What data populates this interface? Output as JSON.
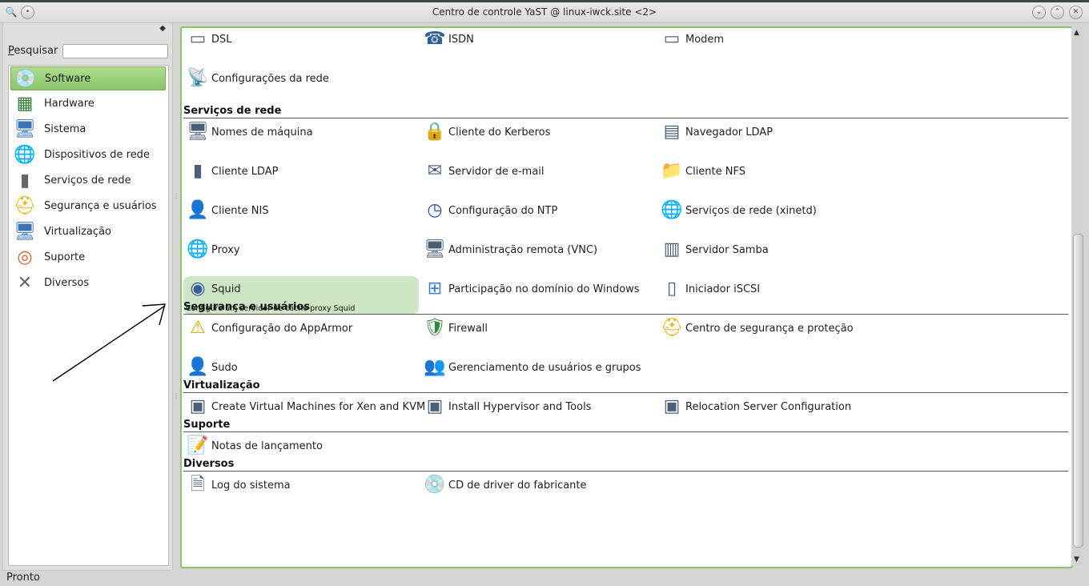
{
  "window": {
    "title": "Centro de controle YaST @ linux-iwck.site <2>"
  },
  "left": {
    "search_label": "Pesquisar",
    "search_value": "",
    "categories": [
      {
        "label": "Software",
        "icon": "software-icon",
        "active": true
      },
      {
        "label": "Hardware",
        "icon": "hardware-icon"
      },
      {
        "label": "Sistema",
        "icon": "system-monitor-icon"
      },
      {
        "label": "Dispositivos de rede",
        "icon": "network-globe-icon"
      },
      {
        "label": "Serviços de rede",
        "icon": "network-services-icon"
      },
      {
        "label": "Segurança e usuários",
        "icon": "security-helmet-icon"
      },
      {
        "label": "Virtualização",
        "icon": "virtualization-icon"
      },
      {
        "label": "Suporte",
        "icon": "lifebuoy-icon"
      },
      {
        "label": "Diversos",
        "icon": "tools-icon"
      }
    ]
  },
  "main": {
    "top_items": [
      {
        "label": "DSL",
        "icon": "dsl-modem-icon"
      },
      {
        "label": "ISDN",
        "icon": "isdn-phone-icon"
      },
      {
        "label": "Modem",
        "icon": "modem-icon"
      },
      {
        "label": "Configurações da rede",
        "icon": "network-settings-icon"
      }
    ],
    "sections": [
      {
        "title": "Serviços de rede",
        "items": [
          {
            "label": "Nomes de máquina",
            "icon": "hostnames-icon"
          },
          {
            "label": "Cliente do Kerberos",
            "icon": "kerberos-lock-icon"
          },
          {
            "label": "Navegador LDAP",
            "icon": "ldap-browser-icon"
          },
          {
            "label": "Cliente LDAP",
            "icon": "ldap-client-icon"
          },
          {
            "label": "Servidor de e-mail",
            "icon": "mail-server-icon"
          },
          {
            "label": "Cliente NFS",
            "icon": "nfs-folder-icon"
          },
          {
            "label": "Cliente NIS",
            "icon": "nis-user-icon"
          },
          {
            "label": "Configuração do NTP",
            "icon": "ntp-clock-icon"
          },
          {
            "label": "Serviços de rede (xinetd)",
            "icon": "xinetd-globe-icon"
          },
          {
            "label": "Proxy",
            "icon": "proxy-globe-icon"
          },
          {
            "label": "Administração remota (VNC)",
            "icon": "vnc-monitors-icon"
          },
          {
            "label": "Servidor Samba",
            "icon": "samba-server-icon"
          },
          {
            "label": "Squid",
            "icon": "squid-icon",
            "highlight": true,
            "description": "Configure um servidor de cache proxy Squid"
          },
          {
            "label": "Participação no domínio do Windows",
            "icon": "windows-domain-icon"
          },
          {
            "label": "Iniciador iSCSI",
            "icon": "iscsi-icon"
          }
        ]
      },
      {
        "title": "Segurança e usuários",
        "items": [
          {
            "label": "Configuração do AppArmor",
            "icon": "apparmor-shield-icon"
          },
          {
            "label": "Firewall",
            "icon": "firewall-shield-icon"
          },
          {
            "label": "Centro de segurança e proteção",
            "icon": "security-center-helmet-icon"
          },
          {
            "label": "Sudo",
            "icon": "sudo-user-icon"
          },
          {
            "label": "Gerenciamento de usuários e grupos",
            "icon": "users-groups-icon"
          }
        ]
      },
      {
        "title": "Virtualização",
        "items": [
          {
            "label": "Create Virtual Machines for Xen and KVM",
            "icon": "vm-create-icon"
          },
          {
            "label": "Install Hypervisor and Tools",
            "icon": "vm-install-icon"
          },
          {
            "label": "Relocation Server Configuration",
            "icon": "vm-relocation-icon"
          }
        ]
      },
      {
        "title": "Suporte",
        "items": [
          {
            "label": "Notas de lançamento",
            "icon": "release-notes-icon"
          }
        ]
      },
      {
        "title": "Diversos",
        "items": [
          {
            "label": "Log do sistema",
            "icon": "system-log-icon"
          },
          {
            "label": "CD de driver do fabricante",
            "icon": "vendor-driver-cd-icon"
          }
        ]
      }
    ]
  },
  "status": {
    "text": "Pronto"
  }
}
